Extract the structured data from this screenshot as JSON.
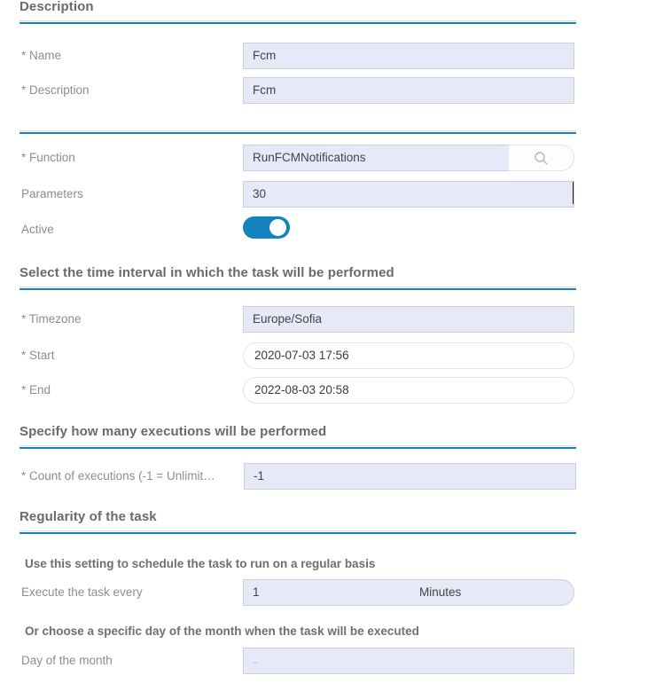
{
  "sections": {
    "description": {
      "title": "Description"
    },
    "time_interval": {
      "title": "Select the time interval in which the task will be performed"
    },
    "executions": {
      "title": "Specify how many executions will be performed"
    },
    "regularity": {
      "title": "Regularity of the task",
      "note_regular": "Use this setting to schedule the task to run on a regular basis",
      "note_day": "Or choose a specific day of the month when the task will be executed"
    }
  },
  "fields": {
    "name": {
      "label": "* Name",
      "value": "Fcm"
    },
    "description": {
      "label": "* Description",
      "value": "Fcm"
    },
    "function": {
      "label": "* Function",
      "value": "RunFCMNotifications",
      "search_icon": "search-icon"
    },
    "parameters": {
      "label": "Parameters",
      "value": "30"
    },
    "active": {
      "label": "Active",
      "state": "on"
    },
    "timezone": {
      "label": "* Timezone",
      "value": "Europe/Sofia"
    },
    "start": {
      "label": "* Start",
      "value": "2020-07-03 17:56"
    },
    "end": {
      "label": "* End",
      "value": "2022-08-03 20:58"
    },
    "count_of_executions": {
      "label": "* Count of executions (-1 = Unlimit…",
      "value": "-1"
    },
    "execute_every": {
      "label": "Execute the task every",
      "value": "1",
      "unit": "Minutes"
    },
    "day_of_month": {
      "label": "Day of the month",
      "value": ".."
    }
  },
  "colors": {
    "accent_blue": "#1482bd",
    "field_bg": "#e5e9f8",
    "label_gray": "#8d8d8d",
    "heading_gray": "#6a6a6a"
  }
}
